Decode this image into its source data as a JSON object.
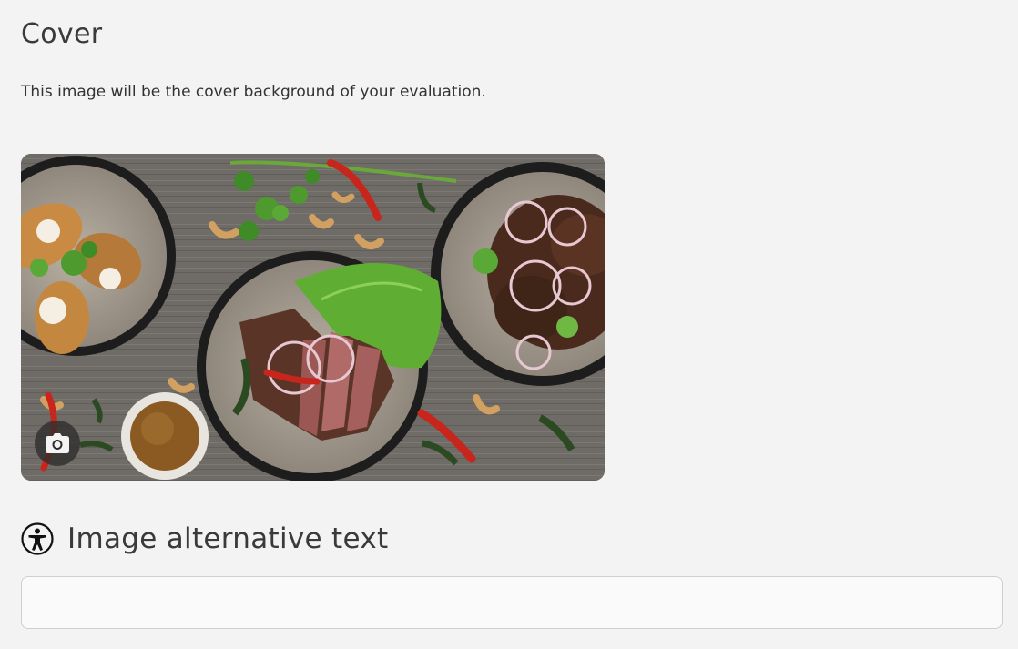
{
  "cover": {
    "title": "Cover",
    "description": "This image will be the cover background of your evaluation.",
    "image": {
      "subject": "food-platter-photo",
      "camera_icon": "camera-icon"
    }
  },
  "alt_text": {
    "icon": "accessibility-icon",
    "label": "Image alternative text",
    "value": "",
    "placeholder": ""
  },
  "colors": {
    "background": "#f3f3f3",
    "text": "#333333",
    "input_border": "#cfcfcf"
  }
}
